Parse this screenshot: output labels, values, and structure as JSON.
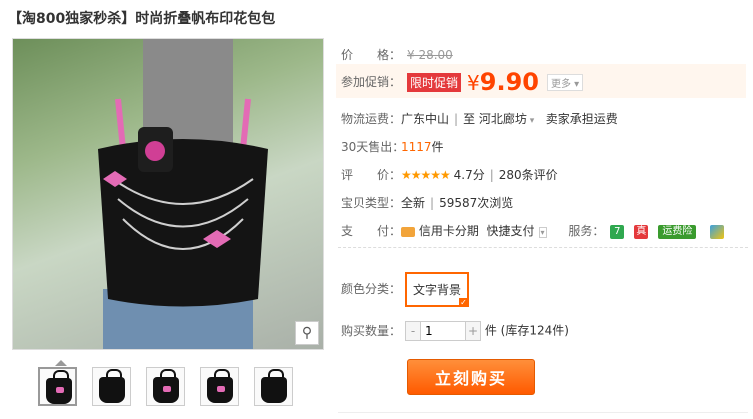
{
  "product": {
    "title": "【淘800独家秒杀】时尚折叠帆布印花包包"
  },
  "price": {
    "label": "价　　格：",
    "original": "¥ 28.00"
  },
  "promo": {
    "label": "参加促销：",
    "tag": "限时促销",
    "currency": "¥",
    "value": "9.90",
    "more": "更多 ▾"
  },
  "shipping": {
    "label": "物流运费：",
    "from": "广东中山",
    "to_prefix": "至",
    "to": "河北廊坊",
    "fee": "卖家承担运费"
  },
  "sales": {
    "label": "30天售出：",
    "count": "1117",
    "unit": "件"
  },
  "rating": {
    "label": "评　　价：",
    "stars": "★★★★★",
    "score": "4.7分",
    "reviews": "280条评价"
  },
  "type": {
    "label": "宝贝类型：",
    "condition": "全新",
    "views": "59587次浏览"
  },
  "payment": {
    "label": "支　　付：",
    "credit": "信用卡分期",
    "quick": "快捷支付",
    "service_label": "服务：",
    "service_badge": "运费险"
  },
  "color": {
    "label": "颜色分类：",
    "option": "文字背景"
  },
  "quantity": {
    "label": "购买数量：",
    "value": "1",
    "unit": "件",
    "stock": "(库存124件)",
    "minus": "-",
    "plus": "+"
  },
  "buy_button": "立刻购买",
  "icons": {
    "zoom": "magnifier-icon"
  },
  "colors": {
    "accent": "#ff4400",
    "tag": "#e4393c"
  }
}
